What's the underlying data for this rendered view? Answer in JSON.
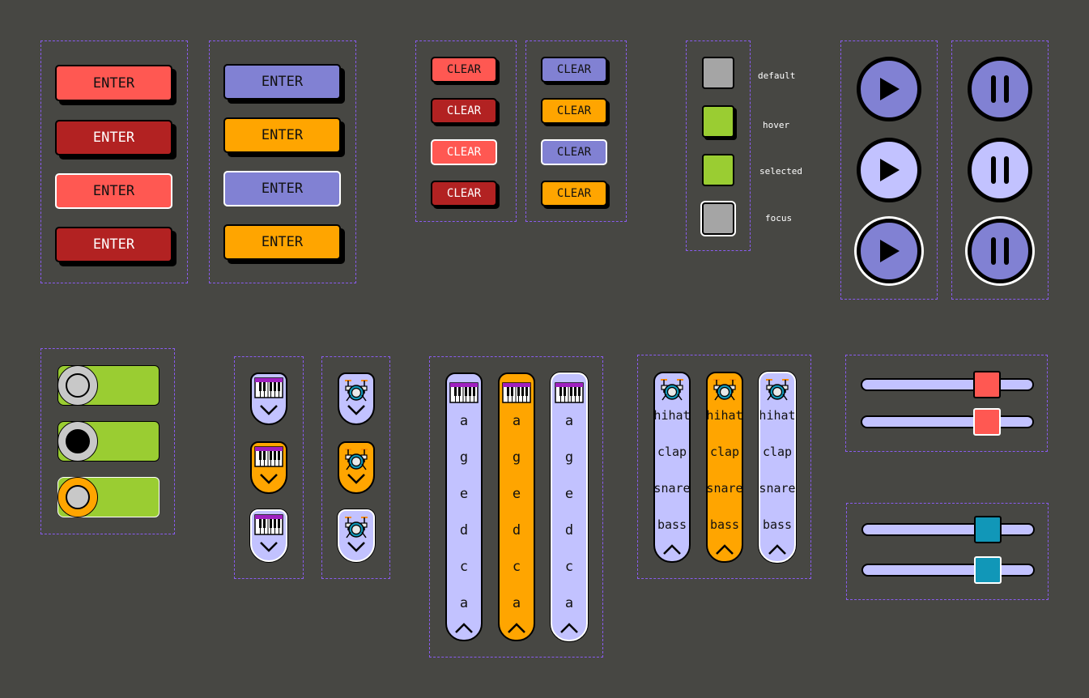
{
  "enter_buttons": {
    "label": "ENTER"
  },
  "clear_buttons": {
    "label": "CLEAR"
  },
  "states": {
    "default": "default",
    "hover": "hover",
    "selected": "selected",
    "focus": "focus"
  },
  "notes_column": [
    "a",
    "g",
    "e",
    "d",
    "c",
    "a"
  ],
  "drums_column": [
    "hihat",
    "clap",
    "snare",
    "bass"
  ],
  "colors": {
    "background": "#474743",
    "dashed_border": "#8a5cf0",
    "red": "#ff5852",
    "dark_red": "#b22222",
    "blue": "#8181d3",
    "lavender": "#c2c2ff",
    "orange": "#ffa500",
    "green": "#9acd32",
    "grey": "#a5a5a5",
    "teal": "#1197b8"
  },
  "sliders": {
    "red_1": 0.77,
    "red_2": 0.77,
    "teal_1": 0.77,
    "teal_2": 0.77
  },
  "icons": [
    "piano-icon",
    "drum-kit-icon",
    "chevron-down-icon",
    "chevron-up-icon",
    "play-icon",
    "pause-icon"
  ]
}
